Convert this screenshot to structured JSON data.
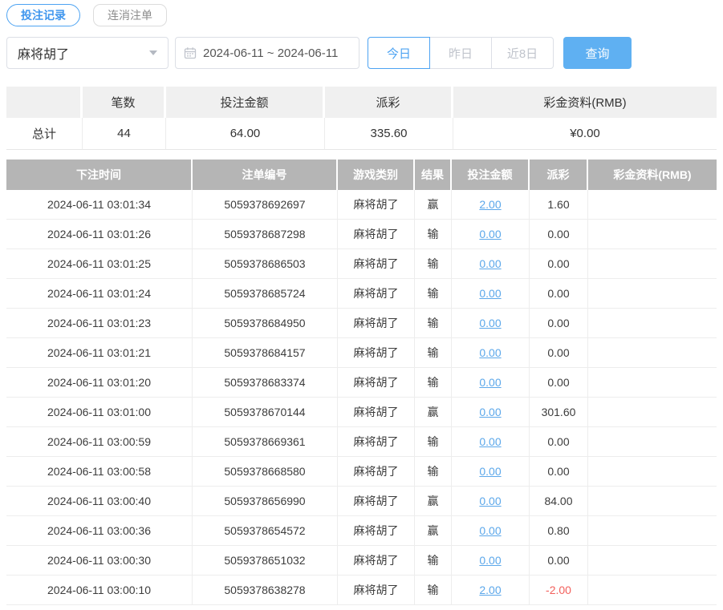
{
  "tabs": [
    {
      "label": "投注记录",
      "active": true
    },
    {
      "label": "连消注单",
      "active": false
    }
  ],
  "filters": {
    "game_select": {
      "value": "麻将胡了",
      "icon": "chevron-down-icon"
    },
    "date_range": {
      "value": "2024-06-11 ~ 2024-06-11",
      "icon": "calendar-icon"
    },
    "quick_buttons": [
      {
        "label": "今日",
        "active": true
      },
      {
        "label": "昨日",
        "active": false
      },
      {
        "label": "近8日",
        "active": false
      }
    ],
    "search_label": "查询"
  },
  "summary": {
    "headers": [
      "",
      "笔数",
      "投注金额",
      "派彩",
      "彩金资料(RMB)"
    ],
    "row_label": "总计",
    "count": "44",
    "bet_total": "64.00",
    "payout_total": "335.60",
    "jackpot_total": "¥0.00"
  },
  "table": {
    "headers": [
      "下注时间",
      "注单编号",
      "游戏类别",
      "结果",
      "投注金额",
      "派彩",
      "彩金资料(RMB)"
    ],
    "rows": [
      {
        "time": "2024-06-11 03:01:34",
        "order_id": "5059378692697",
        "game": "麻将胡了",
        "result": "赢",
        "bet": "2.00",
        "payout": "1.60",
        "jackpot": ""
      },
      {
        "time": "2024-06-11 03:01:26",
        "order_id": "5059378687298",
        "game": "麻将胡了",
        "result": "输",
        "bet": "0.00",
        "payout": "0.00",
        "jackpot": ""
      },
      {
        "time": "2024-06-11 03:01:25",
        "order_id": "5059378686503",
        "game": "麻将胡了",
        "result": "输",
        "bet": "0.00",
        "payout": "0.00",
        "jackpot": ""
      },
      {
        "time": "2024-06-11 03:01:24",
        "order_id": "5059378685724",
        "game": "麻将胡了",
        "result": "输",
        "bet": "0.00",
        "payout": "0.00",
        "jackpot": ""
      },
      {
        "time": "2024-06-11 03:01:23",
        "order_id": "5059378684950",
        "game": "麻将胡了",
        "result": "输",
        "bet": "0.00",
        "payout": "0.00",
        "jackpot": ""
      },
      {
        "time": "2024-06-11 03:01:21",
        "order_id": "5059378684157",
        "game": "麻将胡了",
        "result": "输",
        "bet": "0.00",
        "payout": "0.00",
        "jackpot": ""
      },
      {
        "time": "2024-06-11 03:01:20",
        "order_id": "5059378683374",
        "game": "麻将胡了",
        "result": "输",
        "bet": "0.00",
        "payout": "0.00",
        "jackpot": ""
      },
      {
        "time": "2024-06-11 03:01:00",
        "order_id": "5059378670144",
        "game": "麻将胡了",
        "result": "赢",
        "bet": "0.00",
        "payout": "301.60",
        "jackpot": ""
      },
      {
        "time": "2024-06-11 03:00:59",
        "order_id": "5059378669361",
        "game": "麻将胡了",
        "result": "输",
        "bet": "0.00",
        "payout": "0.00",
        "jackpot": ""
      },
      {
        "time": "2024-06-11 03:00:58",
        "order_id": "5059378668580",
        "game": "麻将胡了",
        "result": "输",
        "bet": "0.00",
        "payout": "0.00",
        "jackpot": ""
      },
      {
        "time": "2024-06-11 03:00:40",
        "order_id": "5059378656990",
        "game": "麻将胡了",
        "result": "赢",
        "bet": "0.00",
        "payout": "84.00",
        "jackpot": ""
      },
      {
        "time": "2024-06-11 03:00:36",
        "order_id": "5059378654572",
        "game": "麻将胡了",
        "result": "赢",
        "bet": "0.00",
        "payout": "0.80",
        "jackpot": ""
      },
      {
        "time": "2024-06-11 03:00:30",
        "order_id": "5059378651032",
        "game": "麻将胡了",
        "result": "输",
        "bet": "0.00",
        "payout": "0.00",
        "jackpot": ""
      },
      {
        "time": "2024-06-11 03:00:10",
        "order_id": "5059378638278",
        "game": "麻将胡了",
        "result": "输",
        "bet": "2.00",
        "payout": "-2.00",
        "jackpot": ""
      }
    ]
  },
  "colors": {
    "accent_blue": "#4da3f2",
    "search_button_blue": "#5fb0f2",
    "link_blue": "#5ba7ea",
    "negative_red": "#f2605c",
    "table_header_gray": "#b5b5b5",
    "summary_header_bg": "#f0f0f0"
  }
}
